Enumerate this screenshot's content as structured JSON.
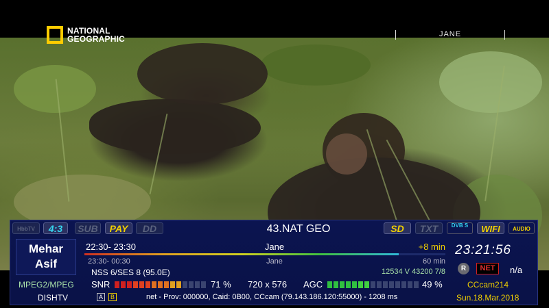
{
  "video": {
    "channel_logo": {
      "text": "NATIONAL GEOGRAPHIC",
      "icon": "national-geographic-logo"
    },
    "program_banner": "JANE"
  },
  "infobar": {
    "flags": {
      "hbbtv": {
        "label": "HbbTV",
        "active": false
      },
      "aspect": {
        "label": "4:3",
        "active": true
      },
      "sub": {
        "label": "SUB",
        "active": false
      },
      "pay": {
        "label": "PAY",
        "active": true
      },
      "dd": {
        "label": "DD",
        "active": false
      },
      "sd": {
        "label": "SD",
        "active": true
      },
      "txt": {
        "label": "TXT",
        "active": false
      },
      "dvbs": {
        "label": "DVB S",
        "active": true
      },
      "wifi": {
        "label": "WIFI",
        "active": true
      },
      "audio": {
        "label": "AUDIO",
        "active": true
      }
    },
    "channel_name": "43.NAT GEO",
    "user_name": "Mehar Asif",
    "now": {
      "time": "22:30- 23:30",
      "title": "Jane",
      "remaining": "+8 min",
      "progress_fraction": 0.87
    },
    "next": {
      "time": "23:30- 00:30",
      "title": "Jane",
      "duration": "60 min"
    },
    "clock": "23:21:56",
    "rec_badge": "R",
    "net_badge": "NET",
    "na_text": "n/a",
    "satellite": "NSS 6/SES 8 (95.0E)",
    "transponder": "12534 V 43200 7/8",
    "codec": "MPEG2/MPEG",
    "provider": "DISHTV",
    "snr": {
      "label": "SNR",
      "value": "71 %",
      "level": 0.71
    },
    "resolution": "720 x 576",
    "agc": {
      "label": "AGC",
      "value": "49 %",
      "level": 0.49
    },
    "cam_name": "CCcam214",
    "date": "Sun.18.Mar.2018",
    "ab": {
      "a": "A",
      "b": "B"
    },
    "ecm_info": "net - Prov: 000000, Caid: 0B00, CCcam (79.143.186.120:55000) - 1208 ms"
  },
  "colors": {
    "bar_bg": "#0b1450",
    "yellow": "#f2d000",
    "cyan": "#36d6f0",
    "red": "#d02020"
  }
}
